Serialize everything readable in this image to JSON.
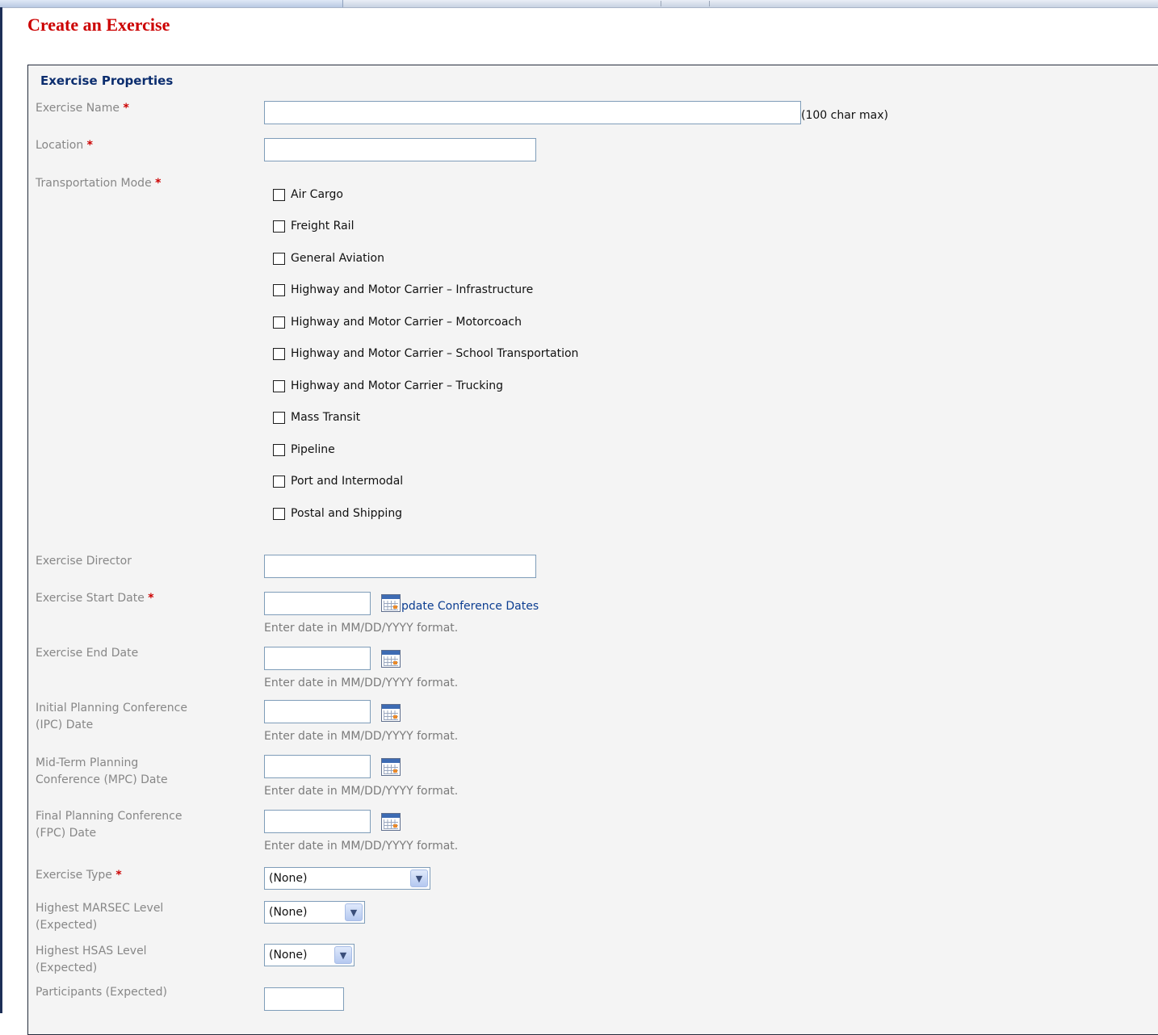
{
  "page": {
    "title": "Create an Exercise"
  },
  "section": {
    "heading": "Exercise Properties"
  },
  "fields": {
    "exercise_name": {
      "label": "Exercise Name",
      "required": "*",
      "value": "",
      "note": "(100 char max)"
    },
    "location": {
      "label": "Location",
      "required": "*",
      "value": ""
    },
    "transportation_mode": {
      "label": "Transportation Mode",
      "required": "*",
      "options": [
        "Air Cargo",
        "Freight Rail",
        "General Aviation",
        "Highway and Motor Carrier – Infrastructure",
        "Highway and Motor Carrier – Motorcoach",
        "Highway and Motor Carrier – School Transportation",
        "Highway and Motor Carrier – Trucking",
        "Mass Transit",
        "Pipeline",
        "Port and Intermodal",
        "Postal and Shipping"
      ]
    },
    "exercise_director": {
      "label": "Exercise Director",
      "value": ""
    },
    "start_date": {
      "label": "Exercise Start Date",
      "required": "*",
      "value": "",
      "link": "pdate Conference Dates",
      "hint": "Enter date in MM/DD/YYYY format."
    },
    "end_date": {
      "label": "Exercise End Date",
      "value": "",
      "hint": "Enter date in MM/DD/YYYY format."
    },
    "ipc_date": {
      "label_line1": "Initial Planning Conference",
      "label_line2": "(IPC) Date",
      "value": "",
      "hint": "Enter date in MM/DD/YYYY format."
    },
    "mpc_date": {
      "label_line1": "Mid-Term Planning",
      "label_line2": "Conference (MPC) Date",
      "value": "",
      "hint": "Enter date in MM/DD/YYYY format."
    },
    "fpc_date": {
      "label_line1": "Final Planning Conference",
      "label_line2": "(FPC) Date",
      "value": "",
      "hint": "Enter date in MM/DD/YYYY format."
    },
    "exercise_type": {
      "label": "Exercise Type",
      "required": "*",
      "selected": "(None)"
    },
    "marsec_level": {
      "label_line1": "Highest MARSEC Level",
      "label_line2": "(Expected)",
      "selected": "(None)"
    },
    "hsas_level": {
      "label_line1": "Highest HSAS Level",
      "label_line2": "(Expected)",
      "selected": "(None)"
    },
    "participants": {
      "label": "Participants (Expected)",
      "value": ""
    }
  },
  "icons": {
    "calendar": "calendar-icon",
    "dropdown": "chevron-down-icon"
  },
  "colors": {
    "title": "#cc0000",
    "section_heading": "#0b2d6e",
    "link": "#0b3d91",
    "panel_bg": "#f4f4f4"
  }
}
